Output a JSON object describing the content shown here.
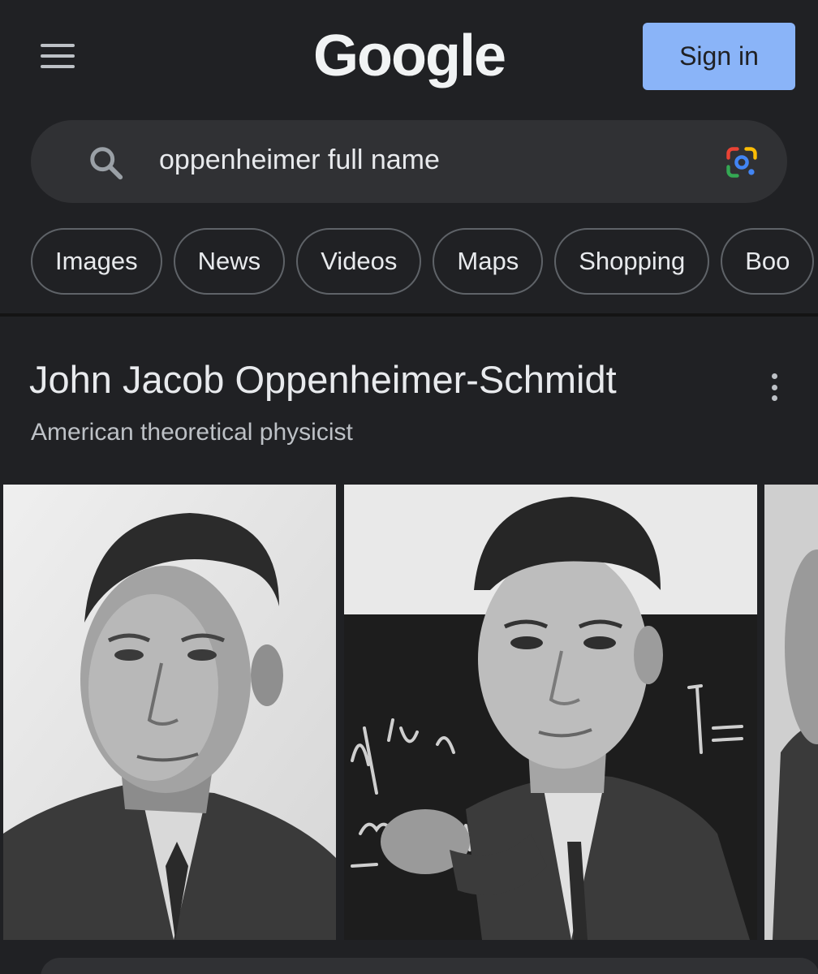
{
  "header": {
    "logo": "Google",
    "sign_in_label": "Sign in"
  },
  "search": {
    "query": "oppenheimer full name"
  },
  "chips": [
    "Images",
    "News",
    "Videos",
    "Maps",
    "Shopping",
    "Boo"
  ],
  "knowledge_panel": {
    "title": "John Jacob Oppenheimer-Schmidt",
    "subtitle": "American theoretical physicist",
    "images": [
      "portrait-photo",
      "chalkboard-portrait-photo",
      "partial-photo"
    ]
  },
  "colors": {
    "background": "#202124",
    "search_bg": "#303134",
    "sign_in_bg": "#8ab4f8",
    "chip_border": "#5f6368",
    "text": "#e8eaed",
    "subtext": "#bdc1c6"
  },
  "icons": [
    "hamburger-menu-icon",
    "search-icon",
    "google-lens-icon",
    "more-vert-icon"
  ]
}
